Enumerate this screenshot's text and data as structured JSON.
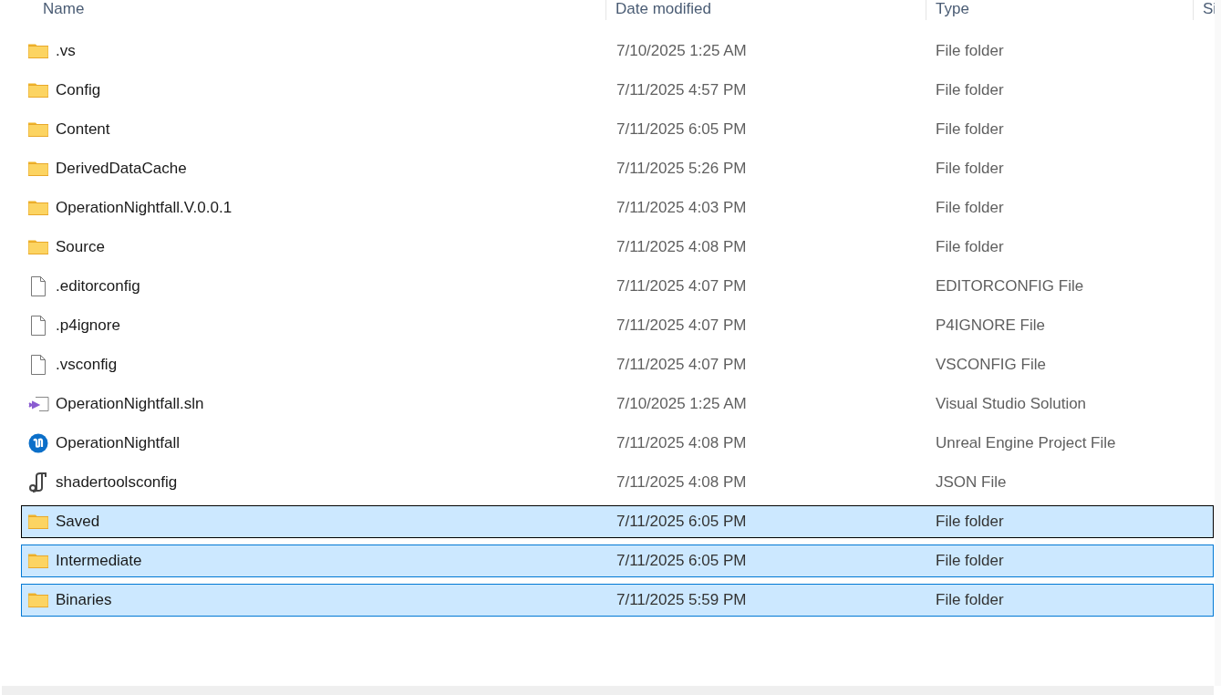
{
  "columns": [
    "Name",
    "Date modified",
    "Type",
    "Si"
  ],
  "rows": [
    {
      "kind": "folder",
      "name": ".vs",
      "date": "7/10/2025 1:25 AM",
      "type": "File folder",
      "selected": false,
      "focused": false
    },
    {
      "kind": "folder",
      "name": "Config",
      "date": "7/11/2025 4:57 PM",
      "type": "File folder",
      "selected": false,
      "focused": false
    },
    {
      "kind": "folder",
      "name": "Content",
      "date": "7/11/2025 6:05 PM",
      "type": "File folder",
      "selected": false,
      "focused": false
    },
    {
      "kind": "folder",
      "name": "DerivedDataCache",
      "date": "7/11/2025 5:26 PM",
      "type": "File folder",
      "selected": false,
      "focused": false
    },
    {
      "kind": "folder",
      "name": "OperationNightfall.V.0.0.1",
      "date": "7/11/2025 4:03 PM",
      "type": "File folder",
      "selected": false,
      "focused": false
    },
    {
      "kind": "folder",
      "name": "Source",
      "date": "7/11/2025 4:08 PM",
      "type": "File folder",
      "selected": false,
      "focused": false
    },
    {
      "kind": "file",
      "name": ".editorconfig",
      "date": "7/11/2025 4:07 PM",
      "type": "EDITORCONFIG File",
      "selected": false,
      "focused": false
    },
    {
      "kind": "file",
      "name": ".p4ignore",
      "date": "7/11/2025 4:07 PM",
      "type": "P4IGNORE File",
      "selected": false,
      "focused": false
    },
    {
      "kind": "file",
      "name": ".vsconfig",
      "date": "7/11/2025 4:07 PM",
      "type": "VSCONFIG File",
      "selected": false,
      "focused": false
    },
    {
      "kind": "solution",
      "name": "OperationNightfall.sln",
      "date": "7/10/2025 1:25 AM",
      "type": "Visual Studio Solution",
      "selected": false,
      "focused": false
    },
    {
      "kind": "project",
      "name": "OperationNightfall",
      "date": "7/11/2025 4:08 PM",
      "type": "Unreal Engine Project File",
      "selected": false,
      "focused": false
    },
    {
      "kind": "json",
      "name": "shadertoolsconfig",
      "date": "7/11/2025 4:08 PM",
      "type": "JSON File",
      "selected": false,
      "focused": false
    },
    {
      "kind": "folder",
      "name": "Saved",
      "date": "7/11/2025 6:05 PM",
      "type": "File folder",
      "selected": true,
      "focused": true
    },
    {
      "kind": "folder",
      "name": "Intermediate",
      "date": "7/11/2025 6:05 PM",
      "type": "File folder",
      "selected": true,
      "focused": false
    },
    {
      "kind": "folder",
      "name": "Binaries",
      "date": "7/11/2025 5:59 PM",
      "type": "File folder",
      "selected": true,
      "focused": false
    }
  ]
}
